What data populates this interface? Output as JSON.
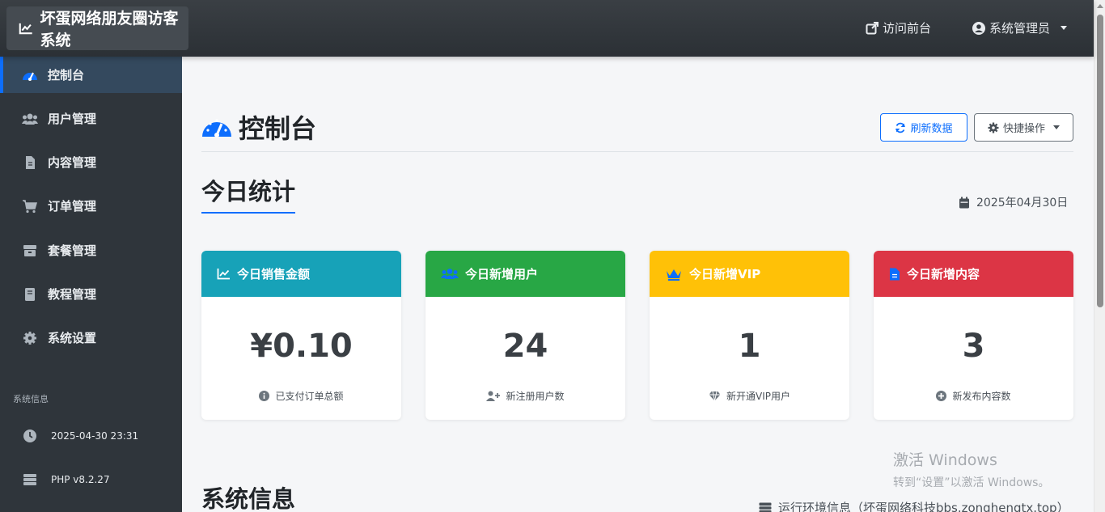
{
  "app": {
    "brand": "坏蛋网络朋友圈访客系统"
  },
  "header": {
    "visit_label": "访问前台",
    "admin_label": "系统管理员"
  },
  "sidebar": {
    "items": [
      {
        "label": "控制台",
        "icon": "dashboard-icon",
        "active": true
      },
      {
        "label": "用户管理",
        "icon": "users-icon"
      },
      {
        "label": "内容管理",
        "icon": "file-icon"
      },
      {
        "label": "订单管理",
        "icon": "cart-icon"
      },
      {
        "label": "套餐管理",
        "icon": "box-icon"
      },
      {
        "label": "教程管理",
        "icon": "book-icon"
      },
      {
        "label": "系统设置",
        "icon": "gear-icon"
      }
    ],
    "system_label": "系统信息",
    "time": "2025-04-30 23:31",
    "php": "PHP v8.2.27"
  },
  "main": {
    "title": "控制台",
    "refresh_label": "刷新数据",
    "quick_label": "快捷操作",
    "today_title": "今日统计",
    "date": "2025年04月30日",
    "cards": [
      {
        "title": "今日销售金额",
        "value": "¥0.10",
        "note": "已支付订单总额",
        "color": "#17a2b8",
        "icon": "chart-line-icon",
        "note_icon": "info-icon"
      },
      {
        "title": "今日新增用户",
        "value": "24",
        "note": "新注册用户数",
        "color": "#28a745",
        "icon": "users-icon",
        "note_icon": "user-plus-icon"
      },
      {
        "title": "今日新增VIP",
        "value": "1",
        "note": "新开通VIP用户",
        "color": "#ffc107",
        "icon": "crown-icon",
        "note_icon": "gem-icon"
      },
      {
        "title": "今日新增内容",
        "value": "3",
        "note": "新发布内容数",
        "color": "#dc3545",
        "icon": "file-icon",
        "note_icon": "plus-circle-icon"
      }
    ],
    "system_title": "系统信息",
    "env_info": "运行环境信息（坏蛋网络科技bbs.zonghengtx.top）"
  },
  "watermark": {
    "line1": "激活 Windows",
    "line2": "转到“设置”以激活 Windows。"
  },
  "colors": {
    "primary": "#0d6efd",
    "sidebar": "#2f353b",
    "topbar": "#343a40"
  }
}
